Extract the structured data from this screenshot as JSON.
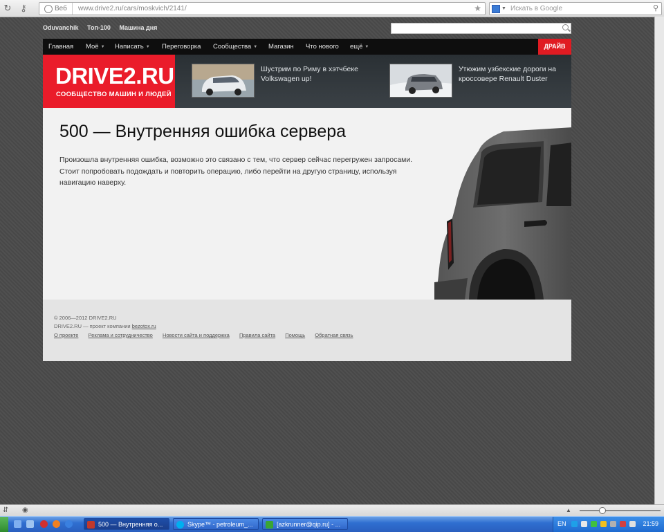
{
  "browser": {
    "mode_label": "Веб",
    "url": "www.drive2.ru/cars/moskvich/2141/",
    "search_placeholder": "Искать в Google"
  },
  "site": {
    "toplinks": [
      "Oduvanchik",
      "Топ-100",
      "Машина дня"
    ],
    "nav": [
      {
        "label": "Главная",
        "caret": false
      },
      {
        "label": "Моё",
        "caret": true
      },
      {
        "label": "Написать",
        "caret": true
      },
      {
        "label": "Переговорка",
        "caret": false
      },
      {
        "label": "Сообщества",
        "caret": true
      },
      {
        "label": "Магазин",
        "caret": false
      },
      {
        "label": "Что нового",
        "caret": false
      },
      {
        "label": "ещё",
        "caret": true
      }
    ],
    "drive_button": "ДРАЙВ",
    "logo": {
      "title": "DRIVE2.RU",
      "tagline": "СООБЩЕСТВО МАШИН И ЛЮДЕЙ"
    },
    "promos": [
      {
        "text": "Шустрим по Риму в хэтчбеке Volkswagen up!"
      },
      {
        "text": "Утюжим узбекские дороги на кроссовере Renault Duster"
      }
    ],
    "error": {
      "title": "500 — Внутренняя ошибка сервера",
      "text": "Произошла внутренняя ошибка, возможно это связано с тем, что сервер сейчас перегружен запросами. Стоит попробовать подождать и повторить операцию, либо перейти на другую страницу, используя навигацию наверху."
    },
    "footer": {
      "copyright": "© 2006—2012 DRIVE2.RU",
      "owner_prefix": "DRIVE2.RU — проект компании",
      "owner_link": "bezotox.ru",
      "links": [
        "О проекте",
        "Реклама и сотрудничество",
        "Новости сайта и поддержка",
        "Правила сайта",
        "Помощь",
        "Обратная связь"
      ]
    }
  },
  "taskbar": {
    "tasks": [
      {
        "label": "500 — Внутренняя о...",
        "active": true,
        "color": "#c0392b"
      },
      {
        "label": "Skype™ - petroleum_...",
        "active": false,
        "color": "#00aff0"
      },
      {
        "label": "[azkrunner@qip.ru] - ...",
        "active": false,
        "color": "#3aa535"
      }
    ],
    "lang": "EN",
    "time": "21:59"
  }
}
